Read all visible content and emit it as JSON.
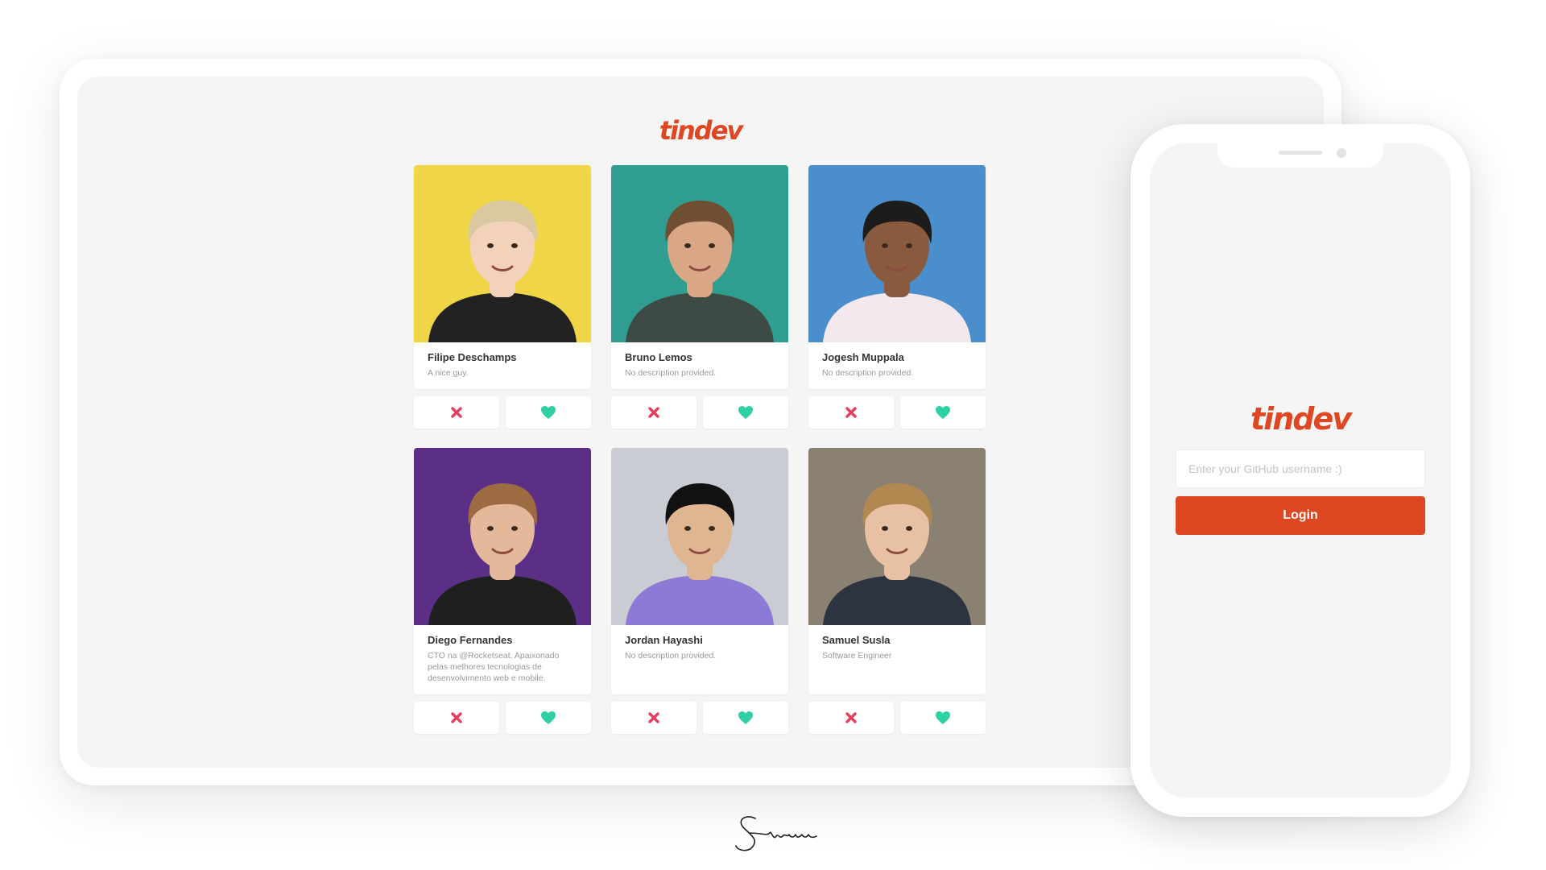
{
  "brand": {
    "logo_text": "tindev",
    "color": "#df4723"
  },
  "colors": {
    "dislike": "#e63e5c",
    "like": "#2ed0a4",
    "background": "#f5f5f5"
  },
  "developers": [
    {
      "name": "Filipe Deschamps",
      "bio": "A nice guy.",
      "photo_bg": "#f0d647",
      "hair": "#d9c8a0",
      "skin": "#f3d2bc",
      "shirt": "#222222"
    },
    {
      "name": "Bruno Lemos",
      "bio": "No description provided.",
      "photo_bg": "#2f9d8f",
      "hair": "#6f4e31",
      "skin": "#d9a785",
      "shirt": "#3e4a44"
    },
    {
      "name": "Jogesh Muppala",
      "bio": "No description provided.",
      "photo_bg": "#4a8fcb",
      "hair": "#1c1c1c",
      "skin": "#8a5a3e",
      "shirt": "#f2e8ee"
    },
    {
      "name": "Diego Fernandes",
      "bio": "CTO na @Rocketseat. Apaixonado pelas melhores tecnologias de desenvolvimento web e mobile.",
      "photo_bg": "#5b2f86",
      "hair": "#9c6b42",
      "skin": "#e3b89b",
      "shirt": "#1f1f1f"
    },
    {
      "name": "Jordan Hayashi",
      "bio": "No description provided.",
      "photo_bg": "#c9ccd3",
      "hair": "#111111",
      "skin": "#e0b592",
      "shirt": "#8c7ad6"
    },
    {
      "name": "Samuel Susla",
      "bio": "Software Engineer",
      "photo_bg": "#8b8173",
      "hair": "#b08850",
      "skin": "#e8c0a4",
      "shirt": "#2c3440"
    }
  ],
  "actions": {
    "dislike_icon": "close-icon",
    "like_icon": "heart-icon"
  },
  "login": {
    "placeholder": "Enter your GitHub username :)",
    "value": "",
    "button_label": "Login"
  }
}
